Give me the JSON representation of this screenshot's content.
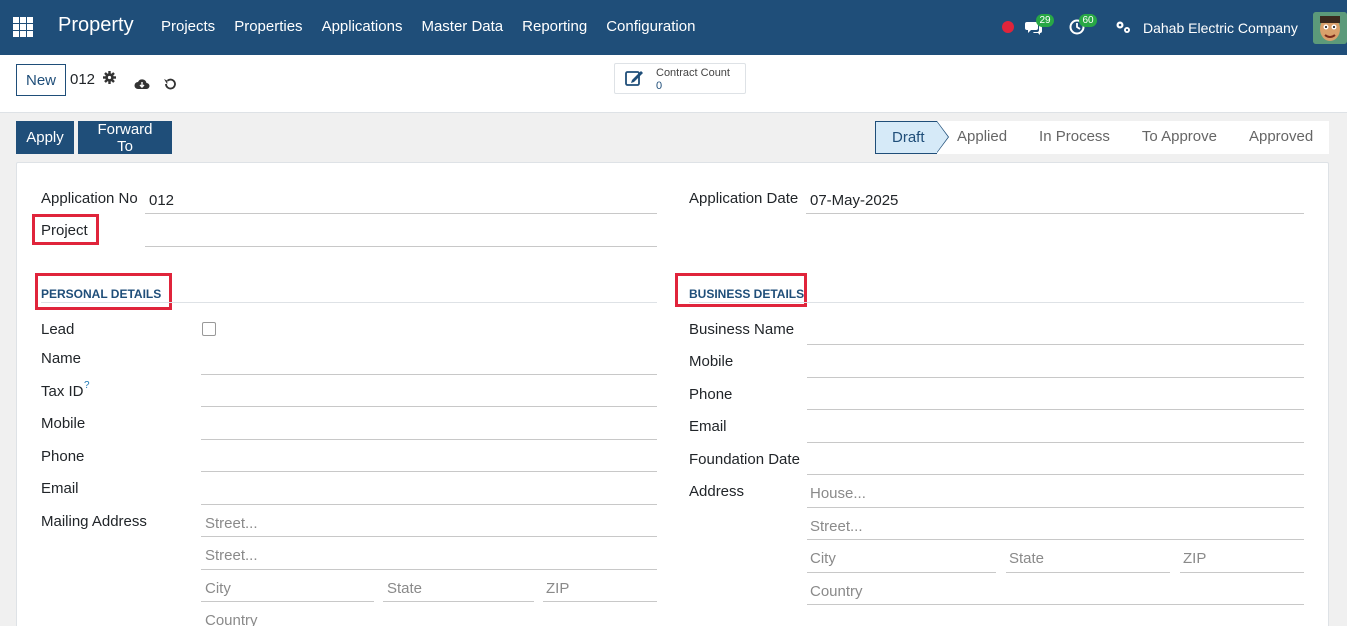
{
  "navbar": {
    "brand": "Property",
    "menu": [
      "Projects",
      "Properties",
      "Applications",
      "Master Data",
      "Reporting",
      "Configuration"
    ],
    "chat_count": "29",
    "activity_count": "60",
    "company": "Dahab Electric Company",
    "bg_color": "#1f4e79"
  },
  "control": {
    "new_label": "New",
    "record_id": "012",
    "smart_button": {
      "label": "Contract Count",
      "value": "0"
    }
  },
  "actions": {
    "apply": "Apply",
    "forward": "Forward To"
  },
  "status": {
    "stages": [
      "Draft",
      "Applied",
      "In Process",
      "To Approve",
      "Approved"
    ],
    "current": "Draft"
  },
  "form": {
    "application_no_label": "Application No",
    "application_no": "012",
    "application_date_label": "Application Date",
    "application_date": "07-May-2025",
    "project_label": "Project",
    "personal": {
      "title": "PERSONAL DETAILS",
      "lead": "Lead",
      "name": "Name",
      "tax_id": "Tax ID",
      "tax_help": "?",
      "mobile": "Mobile",
      "phone": "Phone",
      "email": "Email",
      "mailing_address": "Mailing Address",
      "street_ph": "Street...",
      "street2_ph": "Street...",
      "city_ph": "City",
      "state_ph": "State",
      "zip_ph": "ZIP",
      "country_ph": "Country"
    },
    "business": {
      "title": "BUSINESS DETAILS",
      "business_name": "Business Name",
      "mobile": "Mobile",
      "phone": "Phone",
      "email": "Email",
      "foundation_date": "Foundation Date",
      "address": "Address",
      "house_ph": "House...",
      "street_ph": "Street...",
      "city_ph": "City",
      "state_ph": "State",
      "zip_ph": "ZIP",
      "country_ph": "Country"
    }
  },
  "highlight_color": "#e0243b"
}
